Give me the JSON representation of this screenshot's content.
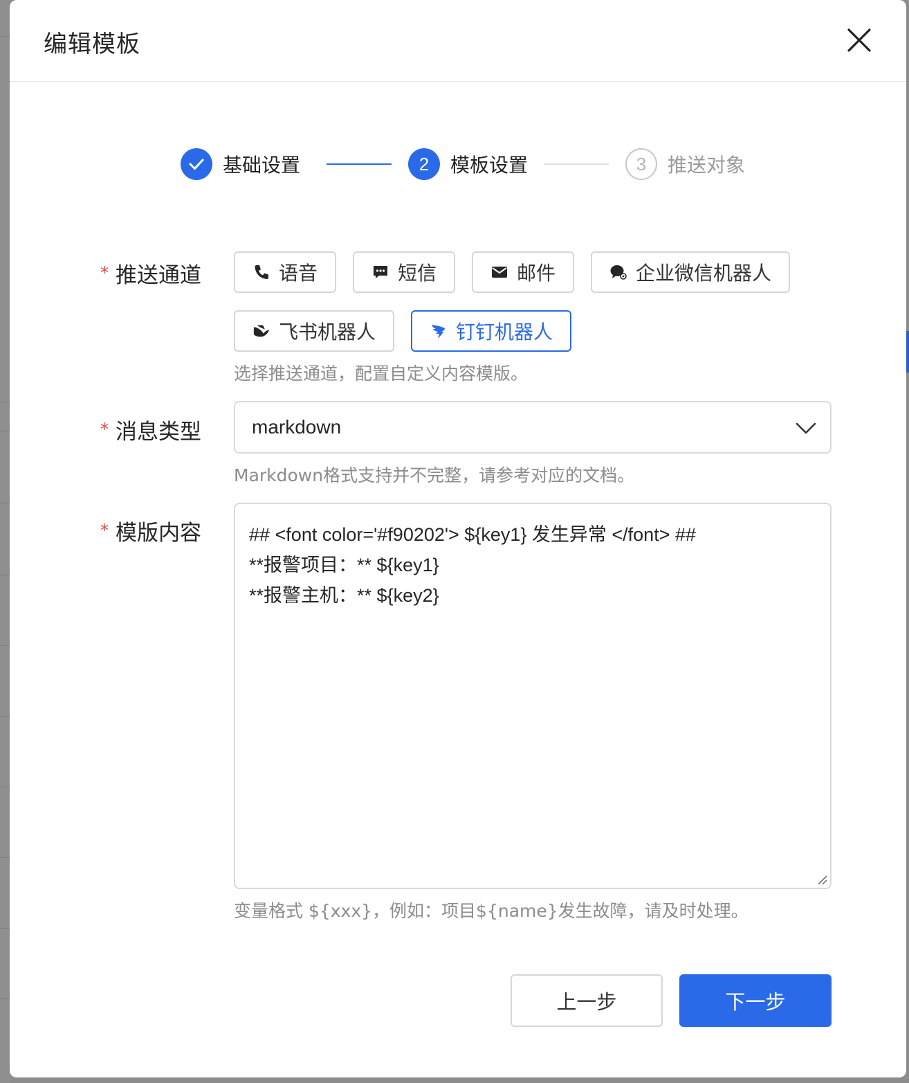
{
  "modal": {
    "title": "编辑模板"
  },
  "steps": [
    {
      "number": "1",
      "label": "基础设置",
      "status": "done"
    },
    {
      "number": "2",
      "label": "模板设置",
      "status": "active"
    },
    {
      "number": "3",
      "label": "推送对象",
      "status": "wait"
    }
  ],
  "form": {
    "channel": {
      "required_mark": "*",
      "label": "推送通道",
      "hint": "选择推送通道，配置自定义内容模版。",
      "options": [
        {
          "label": "语音",
          "icon": "phone-icon",
          "selected": false
        },
        {
          "label": "短信",
          "icon": "message-icon",
          "selected": false
        },
        {
          "label": "邮件",
          "icon": "mail-icon",
          "selected": false
        },
        {
          "label": "企业微信机器人",
          "icon": "wecom-icon",
          "selected": false
        },
        {
          "label": "飞书机器人",
          "icon": "feishu-icon",
          "selected": false
        },
        {
          "label": "钉钉机器人",
          "icon": "dingtalk-icon",
          "selected": true
        }
      ]
    },
    "message_type": {
      "required_mark": "*",
      "label": "消息类型",
      "value": "markdown",
      "hint": "Markdown格式支持并不完整，请参考对应的文档。"
    },
    "template_content": {
      "required_mark": "*",
      "label": "模版内容",
      "lines": [
        "## <font color='#f90202'> ${key1} 发生异常 </font> ##",
        "**报警项目：** ${key1}",
        "**报警主机：** ${key2}"
      ],
      "hint": "变量格式 ${xxx}，例如：项目${name}发生故障，请及时处理。"
    }
  },
  "footer": {
    "prev_label": "上一步",
    "next_label": "下一步"
  },
  "colors": {
    "primary": "#2a6ae9",
    "required": "#e8453c",
    "hint": "#8c8c8c"
  }
}
